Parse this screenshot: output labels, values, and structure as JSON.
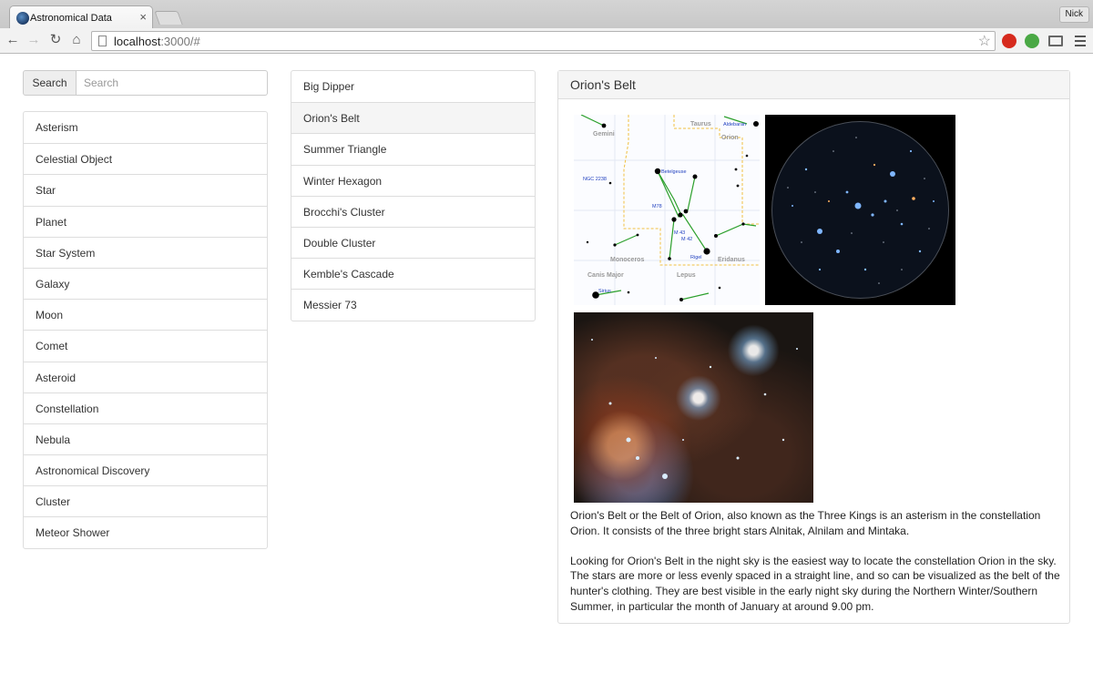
{
  "browser": {
    "tab_title": "Astronomical Data",
    "tab_close": "×",
    "profile_name": "Nick",
    "url_host": "localhost",
    "url_path": ":3000/#"
  },
  "search": {
    "button_label": "Search",
    "placeholder": "Search",
    "value": ""
  },
  "categories": [
    "Asterism",
    "Celestial Object",
    "Star",
    "Planet",
    "Star System",
    "Galaxy",
    "Moon",
    "Comet",
    "Asteroid",
    "Constellation",
    "Nebula",
    "Astronomical Discovery",
    "Cluster",
    "Meteor Shower"
  ],
  "asterisms": {
    "selected": "Orion's Belt",
    "items": [
      "Big Dipper",
      "Orion's Belt",
      "Summer Triangle",
      "Winter Hexagon",
      "Brocchi's Cluster",
      "Double Cluster",
      "Kemble's Cascade",
      "Messier 73"
    ]
  },
  "detail": {
    "title": "Orion's Belt",
    "map_labels": {
      "gemini": "Gemini",
      "taurus": "Taurus",
      "orion": "Orion",
      "aldebaran": "Aldebaran",
      "betelgeuse": "Betelgeuse",
      "ngc": "NGC 2238",
      "m78": "M78",
      "m42": "M 42",
      "m43": "M 43",
      "rigel": "Rigel",
      "monoceros": "Monoceros",
      "eridanus": "Eridanus",
      "canis_major": "Canis Major",
      "lepus": "Lepus",
      "sirius": "Sirius"
    },
    "paragraphs": [
      "Orion's Belt or the Belt of Orion, also known as the Three Kings is an asterism in the constellation Orion. It consists of the three bright stars Alnitak, Alnilam and Mintaka.",
      "Looking for Orion's Belt in the night sky is the easiest way to locate the constellation Orion in the sky. The stars are more or less evenly spaced in a straight line, and so can be visualized as the belt of the hunter's clothing. They are best visible in the early night sky during the Northern Winter/Southern Summer, in particular the month of January at around 9.00 pm."
    ]
  }
}
